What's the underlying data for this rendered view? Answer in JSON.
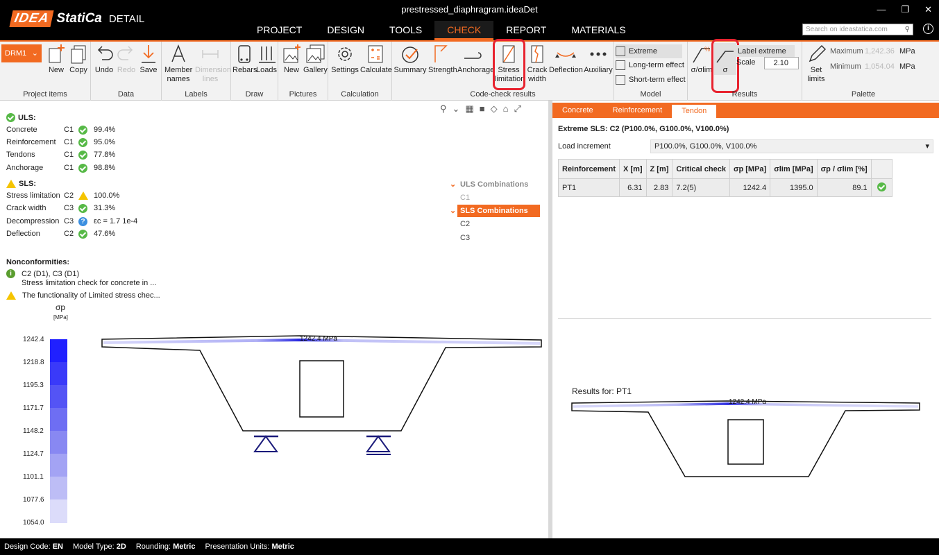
{
  "app": {
    "brand": "IDEA",
    "brand2": "StatiCa",
    "product": "DETAIL",
    "doc_title": "prestressed_diaphragram.ideaDet"
  },
  "window": {
    "minimize": "—",
    "restore": "❐",
    "close": "✕"
  },
  "menu": [
    "PROJECT",
    "DESIGN",
    "TOOLS",
    "CHECK",
    "REPORT",
    "MATERIALS"
  ],
  "search": {
    "placeholder": "Search on ideastatica.com"
  },
  "ribbon": {
    "drm": "DRM1",
    "groups": {
      "project_items": "Project items",
      "data": "Data",
      "labels": "Labels",
      "draw": "Draw",
      "pictures": "Pictures",
      "calculation": "Calculation",
      "code_check": "Code-check results",
      "model": "Model",
      "results": "Results",
      "palette": "Palette"
    },
    "btn": {
      "new": "New",
      "copy": "Copy",
      "undo": "Undo",
      "redo": "Redo",
      "save": "Save",
      "member_names": "Member names",
      "dimension_lines": "Dimension lines",
      "rebars": "Rebars",
      "loads": "Loads",
      "pic_new": "New",
      "gallery": "Gallery",
      "settings": "Settings",
      "calculate": "Calculate",
      "summary": "Summary",
      "strength": "Strength",
      "anchorage": "Anchorage",
      "stress_limitation": "Stress limitation",
      "crack_width": "Crack width",
      "deflection": "Deflection",
      "auxiliary": "Auxiliary",
      "extreme": "Extreme",
      "long_term": "Long-term effect",
      "short_term": "Short-term effect",
      "sigma_ratio": "σ/σlim",
      "sigma": "σ",
      "label_extreme": "Label extreme",
      "scale": "Scale",
      "scale_value": "2.10",
      "set_limits": "Set limits",
      "maximum": "Maximum",
      "maximum_value": "1,242.36",
      "minimum": "Minimum",
      "minimum_value": "1,054.04",
      "unit": "MPa"
    }
  },
  "summary": {
    "uls_title": "ULS:",
    "uls": [
      {
        "name": "Concrete",
        "combo": "C1",
        "status": "ok",
        "value": "99.4%"
      },
      {
        "name": "Reinforcement",
        "combo": "C1",
        "status": "ok",
        "value": "95.0%"
      },
      {
        "name": "Tendons",
        "combo": "C1",
        "status": "ok",
        "value": "77.8%"
      },
      {
        "name": "Anchorage",
        "combo": "C1",
        "status": "ok",
        "value": "98.8%"
      }
    ],
    "sls_title": "SLS:",
    "sls": [
      {
        "name": "Stress limitation",
        "combo": "C2",
        "status": "warn",
        "value": "100.0%"
      },
      {
        "name": "Crack width",
        "combo": "C3",
        "status": "ok",
        "value": "31.3%"
      },
      {
        "name": "Decompression",
        "combo": "C3",
        "status": "info",
        "value": "εc = 1.7 1e-4"
      },
      {
        "name": "Deflection",
        "combo": "C2",
        "status": "ok",
        "value": "47.6%"
      }
    ],
    "nonconf_title": "Nonconformities:",
    "nonconf1_title": "C2 (D1), C3 (D1)",
    "nonconf1_text": "Stress limitation check for concrete in ...",
    "nonconf2_text": "The functionality of Limited stress chec..."
  },
  "combos": {
    "uls_label": "ULS Combinations",
    "uls_items": [
      "C1"
    ],
    "sls_label": "SLS Combinations",
    "sls_items": [
      "C2",
      "C3"
    ]
  },
  "legend": {
    "symbol": "σp",
    "unit": "[MPa]",
    "values": [
      "1242.4",
      "1218.8",
      "1195.3",
      "1171.7",
      "1148.2",
      "1124.7",
      "1101.1",
      "1077.6",
      "1054.0"
    ]
  },
  "drawing": {
    "peak_label": "1242.4 MPa"
  },
  "right": {
    "tabs": [
      "Concrete",
      "Reinforcement",
      "Tendon"
    ],
    "heading": "Extreme SLS: C2 (P100.0%, G100.0%, V100.0%)",
    "load_inc_label": "Load increment",
    "load_inc_value": "P100.0%, G100.0%, V100.0%",
    "table": {
      "headers": [
        "Reinforcement",
        "X [m]",
        "Z [m]",
        "Critical check",
        "σp [MPa]",
        "σlim [MPa]",
        "σp / σlim [%]",
        ""
      ],
      "row": [
        "PT1",
        "6.31",
        "2.83",
        "7.2(5)",
        "1242.4",
        "1395.0",
        "89.1"
      ]
    },
    "results_for": "Results for: PT1",
    "peak_label": "1242.4 MPa"
  },
  "status": {
    "design_code_lbl": "Design Code:",
    "design_code": "EN",
    "model_type_lbl": "Model Type:",
    "model_type": "2D",
    "rounding_lbl": "Rounding:",
    "rounding": "Metric",
    "pres_units_lbl": "Presentation Units:",
    "pres_units": "Metric"
  }
}
